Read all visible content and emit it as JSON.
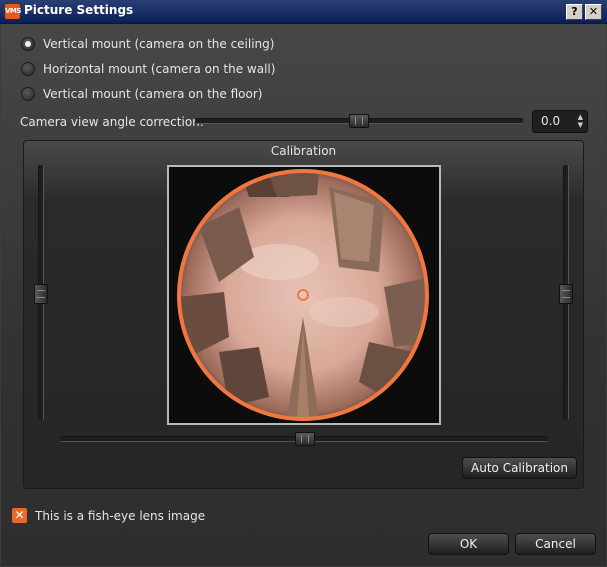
{
  "window": {
    "title": "Picture Settings",
    "app_icon_text": "VMS",
    "help_button": "?",
    "close_button": "✕"
  },
  "mount_options": [
    {
      "label": "Vertical mount (camera on the ceiling)",
      "checked": true
    },
    {
      "label": "Horizontal mount (camera on the wall)",
      "checked": false
    },
    {
      "label": "Vertical mount (camera on the floor)",
      "checked": false
    }
  ],
  "angle_correction": {
    "label": "Camera view angle correction:",
    "value": "0.0",
    "slider_fraction": 0.5
  },
  "calibration": {
    "title": "Calibration",
    "image_alt": "fish-eye camera view of skyscrapers",
    "auto_button": "Auto Calibration",
    "horizontal_slider_fraction": 0.5,
    "left_slider_fraction": 0.47,
    "right_slider_fraction": 0.47,
    "circle_color": "#f07840"
  },
  "fisheye_checkbox": {
    "label": "This is a fish-eye lens image",
    "checked": true,
    "mark": "✕"
  },
  "footer": {
    "ok": "OK",
    "cancel": "Cancel"
  },
  "colors": {
    "accent": "#e8692a",
    "titlebar": "#0b1f57"
  }
}
